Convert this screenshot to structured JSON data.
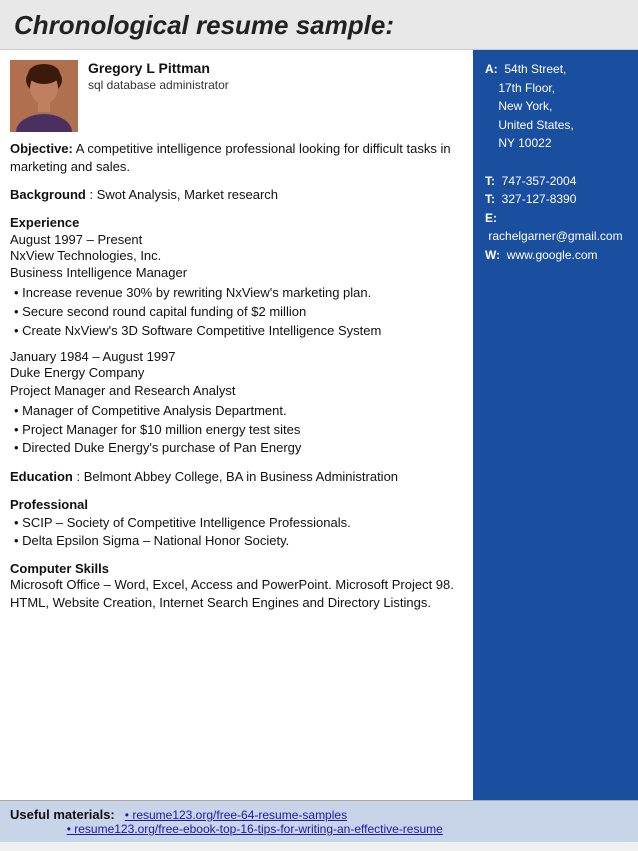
{
  "header": {
    "title": "Chronological resume sample:"
  },
  "profile": {
    "name": "Gregory L Pittman",
    "title": "sql database administrator",
    "photo_alt": "profile photo"
  },
  "objective": {
    "label": "Objective:",
    "text": "A competitive intelligence professional looking for difficult tasks in marketing and sales."
  },
  "background": {
    "label": "Background",
    "text": ": Swot Analysis, Market research"
  },
  "experience": {
    "label": "Experience",
    "jobs": [
      {
        "date": "August 1997 – Present",
        "company": "NxView Technologies, Inc.",
        "role": "Business Intelligence Manager",
        "bullets": [
          "• Increase revenue 30% by rewriting NxView's marketing plan.",
          "• Secure second round capital funding of $2 million",
          "• Create NxView's 3D Software Competitive Intelligence System"
        ]
      },
      {
        "date": "January 1984 – August 1997",
        "company": "Duke Energy Company",
        "role": "Project Manager and Research Analyst",
        "bullets": [
          "• Manager of Competitive Analysis Department.",
          "• Project Manager for $10 million energy test sites",
          "• Directed Duke Energy's purchase of Pan Energy"
        ]
      }
    ]
  },
  "education": {
    "label": "Education",
    "text": ": Belmont Abbey College, BA in Business Administration"
  },
  "professional": {
    "label": "Professional",
    "bullets": [
      "• SCIP – Society of Competitive Intelligence Professionals.",
      "• Delta Epsilon Sigma – National Honor Society."
    ]
  },
  "computer_skills": {
    "label": "Computer Skills",
    "text": "Microsoft Office – Word, Excel, Access and PowerPoint. Microsoft Project 98. HTML, Website Creation, Internet Search Engines and Directory Listings."
  },
  "sidebar": {
    "address_label": "A:",
    "address": "54th Street,\n17th Floor,\nNew York,\nUnited States,\nNY 10022",
    "phone1_label": "T:",
    "phone1": "747-357-2004",
    "phone2_label": "T:",
    "phone2": "327-127-8390",
    "email_label": "E:",
    "email": "rachelgarner@gmail.com",
    "web_label": "W:",
    "web": "www.google.com"
  },
  "footer": {
    "label": "Useful materials:",
    "links": [
      "• resume123.org/free-64-resume-samples",
      "• resume123.org/free-ebook-top-16-tips-for-writing-an-effective-resume"
    ]
  }
}
